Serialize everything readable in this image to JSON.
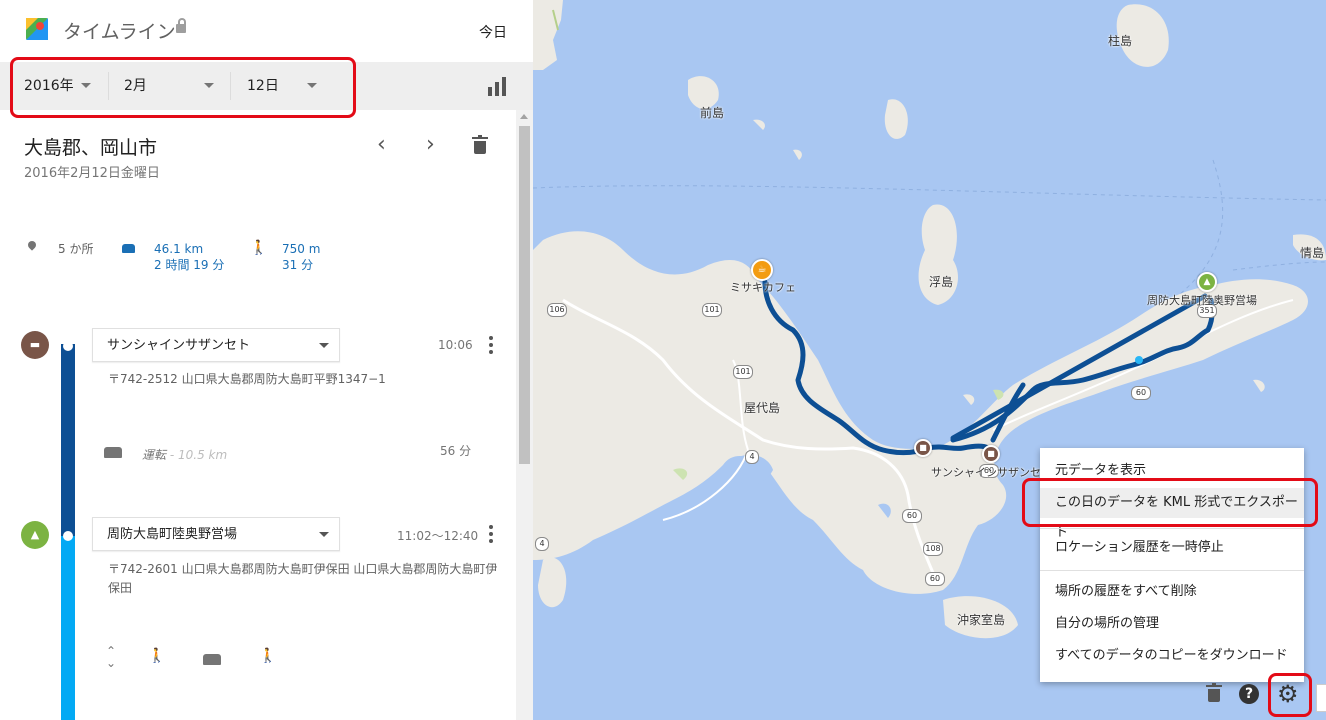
{
  "header": {
    "title": "タイムライン",
    "today": "今日"
  },
  "date_filter": {
    "year": "2016年",
    "month": "2月",
    "day": "12日"
  },
  "location": {
    "title": "大島郡、岡山市",
    "date": "2016年2月12日金曜日"
  },
  "summary": {
    "places": "5 か所",
    "drive_distance": "46.1 km",
    "drive_time": "2 時間 19 分",
    "walk_distance": "750 m",
    "walk_time": "31 分"
  },
  "entries": [
    {
      "name": "サンシャインサザンセト",
      "time": "10:06",
      "address": "〒742-2512 山口県大島郡周防大島町平野1347−1",
      "color": "#795548"
    },
    {
      "name": "周防大島町陸奥野営場",
      "time": "11:02〜12:40",
      "address": "〒742-2601 山口県大島郡周防大島町伊保田 山口県大島郡周防大島町伊保田",
      "color": "#7cb342"
    }
  ],
  "drive": {
    "label": "運転",
    "distance": "- 10.5 km",
    "duration": "56 分"
  },
  "map": {
    "labels": {
      "hashira": "柱島",
      "mae": "前島",
      "uki": "浮島",
      "yashiro": "屋代島",
      "jouna": "情島",
      "okikamuro": "沖家室島",
      "cafe": "ミサキカフェ",
      "camp": "周防大島町陸奥野営場",
      "hotel": "サンシャインサザンセト"
    },
    "routes": [
      "106",
      "101",
      "101",
      "4",
      "4",
      "60",
      "60",
      "108",
      "60",
      "351",
      "60"
    ],
    "route_color": "#0d4f94"
  },
  "menu": {
    "items": [
      "元データを表示",
      "この日のデータを KML 形式でエクスポート",
      "ロケーション履歴を一時停止",
      "場所の履歴をすべて削除",
      "自分の場所の管理",
      "すべてのデータのコピーをダウンロード"
    ]
  },
  "colors": {
    "highlight": "#e30b17",
    "timeline_dark": "#0d4f94",
    "timeline_light": "#03a9f4"
  }
}
